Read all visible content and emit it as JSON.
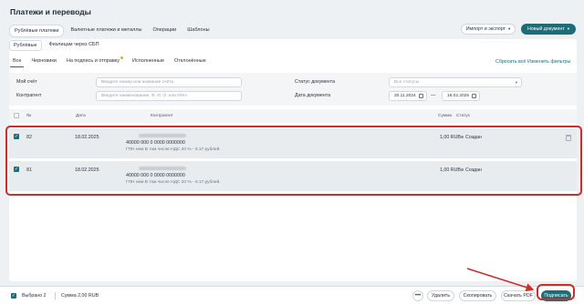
{
  "page": {
    "title": "Платежи и переводы"
  },
  "top_tabs": [
    "Рублёвые платежи",
    "Валютные платежи и металлы",
    "Операции",
    "Шаблоны"
  ],
  "actions": {
    "import_export": "Импорт и экспорт",
    "new_document": "Новый документ"
  },
  "sub_tabs": [
    "Рублёвые",
    "Физлицам через СБП"
  ],
  "filter_tabs": [
    "Все",
    "Черновики",
    "На подпись и отправку",
    "Исполненные",
    "Отклонённые"
  ],
  "links": {
    "reset_all": "Сбросить всё",
    "change_filters": "Изменить фильтры"
  },
  "filters": {
    "my_account": {
      "label": "Мой счёт",
      "placeholder": "Введите номер или название счёта"
    },
    "counterparty": {
      "label": "Контрагент",
      "placeholder": "Введите наименование, Ф. И. О. или ИНН"
    },
    "doc_status": {
      "label": "Статус документа",
      "value": "Все статусы"
    },
    "doc_date": {
      "label": "Дата документа",
      "from": "20.11.2024",
      "dash": "—",
      "to": "18.02.2025"
    }
  },
  "table": {
    "headers": {
      "num": "№",
      "date": "Дата",
      "counterparty": "Контрагент",
      "amount": "Сумма",
      "status": "Статус"
    },
    "rows": [
      {
        "num": "82",
        "date": "18.02.2025",
        "account": "40000 000 0 0000 0000000",
        "purpose": "ГПН нем В том числе НДС 20 % - 0.17 рублей.",
        "amount": "1,00 RUB",
        "status": "Создан"
      },
      {
        "num": "81",
        "date": "18.02.2025",
        "account": "40000 000 0 0000 0000000",
        "purpose": "ГПН нем В том числе НДС 20 % - 0.17 рублей.",
        "amount": "1,00 RUB",
        "status": "Создан"
      }
    ]
  },
  "bottom_bar": {
    "selected": "Выбрано 2",
    "sum": "Сумма 2,00 RUB",
    "more": "•••",
    "delete": "Удалить",
    "copy": "Скопировать",
    "download_pdf": "Скачать PDF",
    "sign": "Подписать"
  },
  "colors": {
    "accent": "#1d6d78",
    "highlight": "#c9302c"
  }
}
